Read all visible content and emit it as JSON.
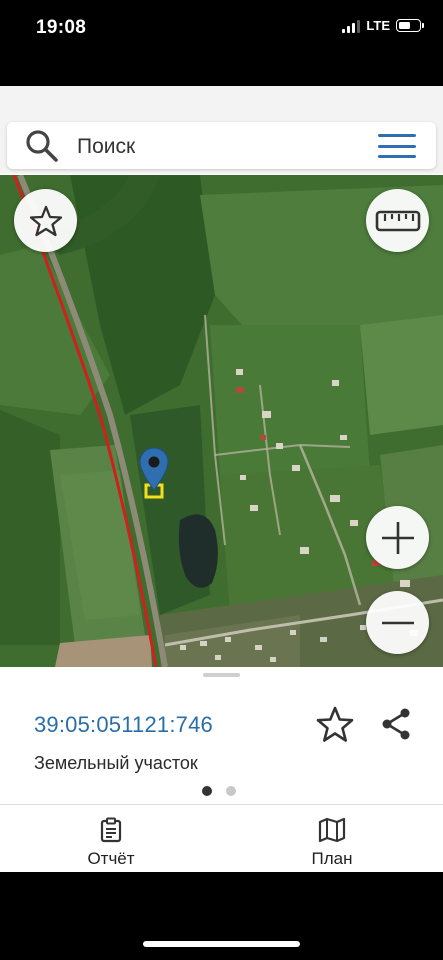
{
  "status_bar": {
    "time": "19:08",
    "network": "LTE",
    "signal_bars": 3,
    "battery_level": 0.6
  },
  "search": {
    "placeholder": "Поиск",
    "icon": "search-icon",
    "menu_icon": "hamburger-menu-icon"
  },
  "map": {
    "controls": {
      "favorite": "star-icon",
      "ruler": "ruler-icon",
      "zoom_in": "plus-icon",
      "zoom_out": "minus-icon",
      "layers": "layers-icon",
      "locate": "navigation-arrow-icon"
    },
    "marker": "location-pin-icon",
    "colors": {
      "boundary_line": "#d0201e",
      "parcel_highlight": "#f2e01a",
      "pin": "#2f6fb0"
    }
  },
  "parcel": {
    "cadastral_number": "39:05:051121:746",
    "type": "Земельный участок"
  },
  "pager": {
    "pages": 2,
    "active_index": 0
  },
  "tabs": [
    {
      "label": "Отчёт",
      "icon": "clipboard-icon"
    },
    {
      "label": "План",
      "icon": "map-icon"
    }
  ],
  "accent_color": "#2a6ea8"
}
